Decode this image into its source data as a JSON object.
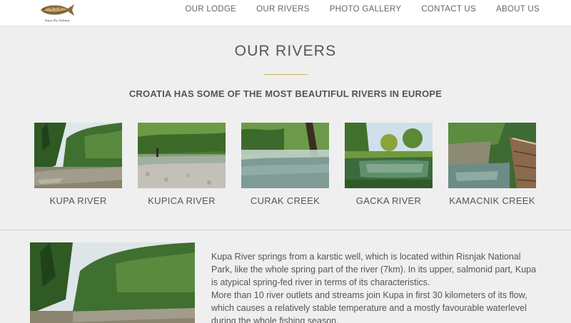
{
  "brand": {
    "logo_text": "Kupa Fly Fishing"
  },
  "nav": {
    "items": [
      {
        "label": "OUR LODGE"
      },
      {
        "label": "OUR RIVERS"
      },
      {
        "label": "PHOTO GALLERY"
      },
      {
        "label": "CONTACT US"
      },
      {
        "label": "ABOUT US"
      }
    ]
  },
  "page": {
    "title": "OUR RIVERS",
    "tagline": "CROATIA HAS SOME OF THE MOST BEAUTIFUL RIVERS IN EUROPE"
  },
  "rivers": [
    {
      "name": "KUPA RIVER"
    },
    {
      "name": "KUPICA RIVER"
    },
    {
      "name": "CURAK CREEK"
    },
    {
      "name": "GACKA RIVER"
    },
    {
      "name": "KAMACNIK CREEK"
    }
  ],
  "detail": {
    "paragraph_1": "Kupa River springs from a karstic well, which is located within Risnjak National Park, like the whole spring part of the river (7km). In its upper, salmonid part, Kupa is atypical spring-fed river in terms of its characteristics.",
    "paragraph_2": "More than 10 river outlets and streams join Kupa in first 30 kilometers of its flow, which causes a relatively stable temperature and a mostly favourable waterlevel during the whole fishing season."
  },
  "colors": {
    "accent_rule": "#c6b45c",
    "background": "#efefef",
    "text": "#555555"
  }
}
